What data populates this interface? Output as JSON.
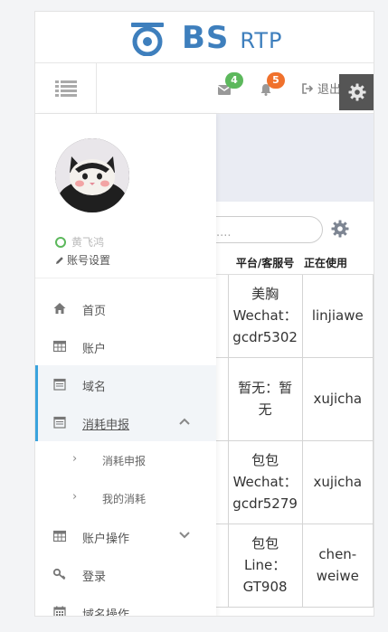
{
  "brand": {
    "logo_main": "BS",
    "logo_sub": "RTP"
  },
  "topnav": {
    "mail_badge": "4",
    "bell_badge": "5",
    "logout_label": "退出",
    "badge_colors": {
      "mail": "#5cb85c",
      "bell": "#f0712c"
    }
  },
  "sidebar": {
    "user_name": "黄飞鸿",
    "account_settings": "账号设置",
    "menu": [
      {
        "label": "首页",
        "icon": "home-icon"
      },
      {
        "label": "账户",
        "icon": "table-icon"
      },
      {
        "label": "域名",
        "icon": "calendar-icon",
        "active": true
      },
      {
        "label": "消耗申报",
        "icon": "calendar-icon",
        "expanded": true
      },
      {
        "label": "消耗申报",
        "submenu": true
      },
      {
        "label": "我的消耗",
        "submenu": true
      },
      {
        "label": "账户操作",
        "icon": "table-icon"
      },
      {
        "label": "登录",
        "icon": "key-icon"
      },
      {
        "label": "域名操作",
        "icon": "calendar-icon"
      }
    ]
  },
  "main": {
    "search_placeholder": "容....",
    "table": {
      "headers": [
        "平台/客服号",
        "正在使用"
      ],
      "rows": [
        {
          "platform": "美胸\nWechat：\ngcdr5302",
          "user": "linjiawe"
        },
        {
          "platform": "暂无：暂\n无",
          "user": "xujicha"
        },
        {
          "platform": "包包\nWechat：\ngcdr5279",
          "user": "xujicha"
        },
        {
          "platform": "包包\nLine：\nGT908",
          "user": "chen-\nweiwe"
        }
      ]
    }
  }
}
